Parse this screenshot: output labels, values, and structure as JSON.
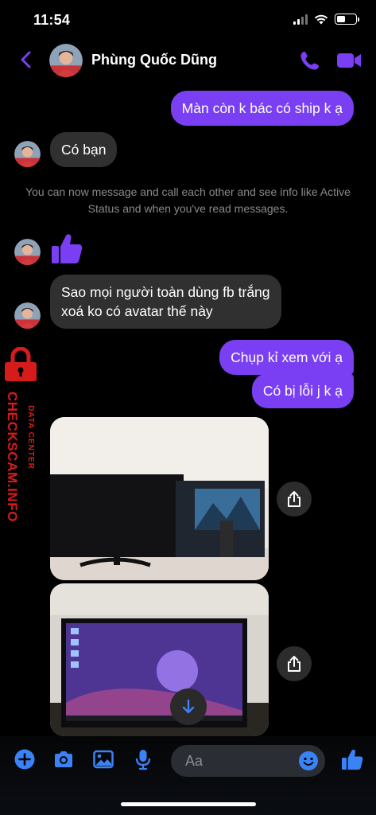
{
  "status_bar": {
    "time": "11:54",
    "battery_level": 0.45
  },
  "header": {
    "contact_name": "Phùng Quốc Dũng"
  },
  "messages": {
    "m1": "Màn còn k bác có ship k ạ",
    "m2": "Có bạn",
    "system_note": "You can now message and call each other and see info like Active Status and when you've read messages.",
    "m3_line1": "Sao mọi người toàn dùng fb trắng",
    "m3_line2": "xoá ko có avatar thế này",
    "m4": "Chụp kỉ xem với ạ",
    "m5": "Có bị lỗi j k ạ"
  },
  "composer": {
    "placeholder": "Aa"
  },
  "watermark": {
    "main": "CHECKSCAM.INFO",
    "sub": "DATA CENTER"
  },
  "colors": {
    "accent": "#7a3ff2",
    "icon_blue": "#3b82f6",
    "incoming_bubble": "#303030",
    "watermark_red": "#d61b1b"
  },
  "icons": [
    "back-icon",
    "phone-icon",
    "video-camera-icon",
    "thumbs-up-icon",
    "share-icon",
    "arrow-down-icon",
    "plus-icon",
    "camera-icon",
    "image-icon",
    "microphone-icon",
    "emoji-icon",
    "lock-icon"
  ]
}
